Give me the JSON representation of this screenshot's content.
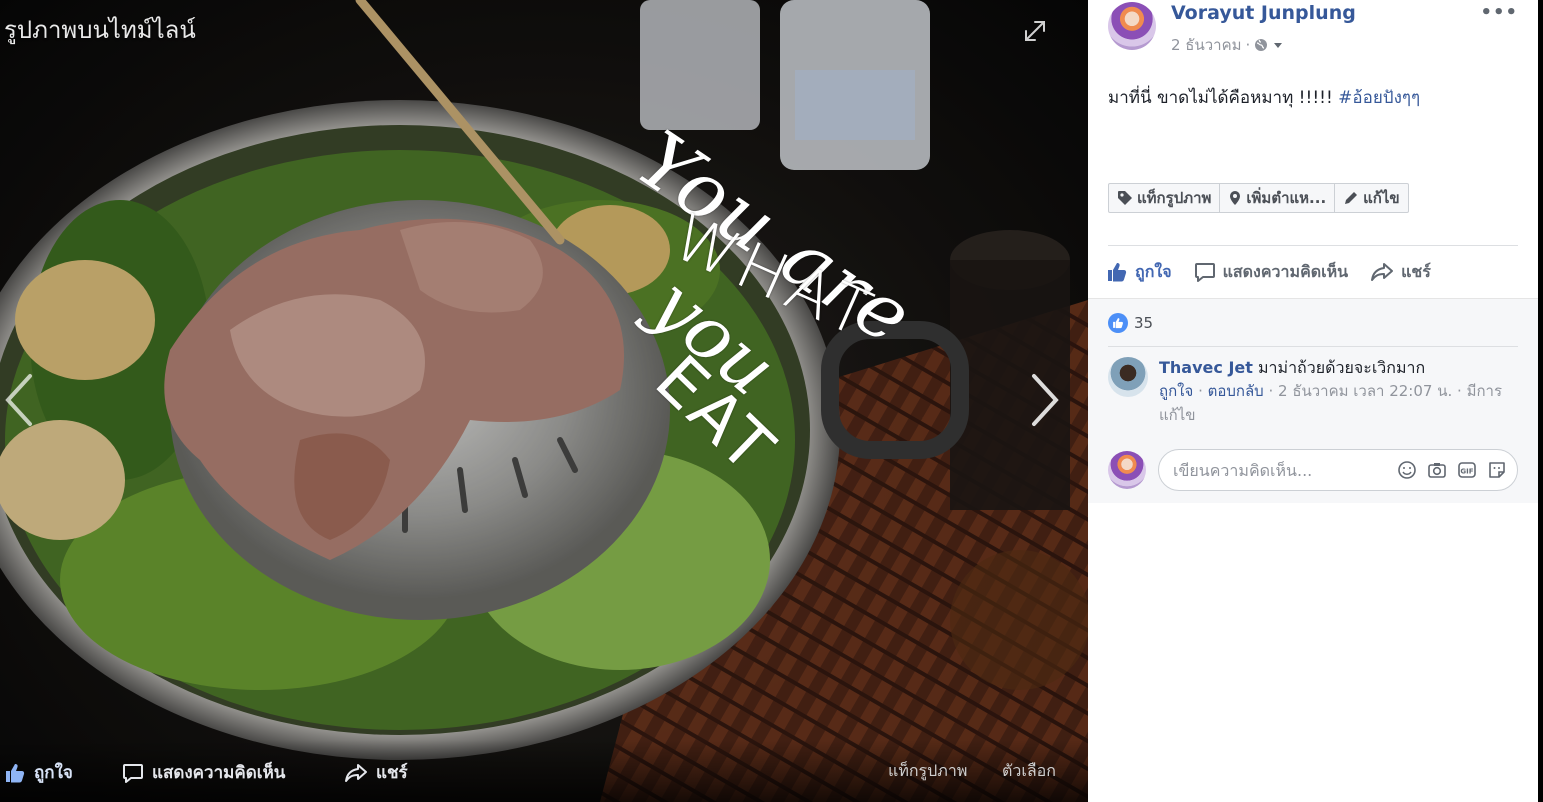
{
  "viewer": {
    "album_title": "รูปภาพบนไทม์ไลน์",
    "overlay_lines": [
      "You are",
      "WHAT",
      "you",
      "EAT"
    ],
    "bottom_actions": {
      "like": "ถูกใจ",
      "comment": "แสดงความคิดเห็น",
      "share": "แชร์"
    },
    "bottom_links": {
      "tag": "แท็กรูปภาพ",
      "options": "ตัวเลือก"
    }
  },
  "post": {
    "author": "Vorayut Junplung",
    "date": "2 ธันวาคม",
    "text": "มาที่นี่ ขาดไม่ได้คือหมาทุ !!!!! ",
    "hashtag": "#อ้อยปังๆๆ",
    "tag_bar": {
      "tag_photo": "แท็กรูปภาพ",
      "add_location": "เพิ่มตำแห...",
      "edit": "แก้ไข"
    },
    "actions": {
      "like": "ถูกใจ",
      "comment": "แสดงความคิดเห็น",
      "share": "แชร์"
    },
    "reaction_count": "35"
  },
  "comments": [
    {
      "name": "Thavec Jet",
      "text": "มาม่าถ้วยด้วยจะเวิกมาก",
      "like": "ถูกใจ",
      "reply": "ตอบกลับ",
      "timestamp": "2 ธันวาคม เวลา 22:07 น.",
      "edited": "มีการแก้ไข"
    }
  ],
  "composer": {
    "placeholder": "เขียนความคิดเห็น..."
  },
  "colors": {
    "link": "#365899",
    "like_blue": "#4267b2",
    "badge": "#4c8ff7",
    "muted": "#90949c"
  },
  "icons": [
    "expand-icon",
    "chevron-left-icon",
    "chevron-right-icon",
    "thumbs-up-icon",
    "comment-icon",
    "share-icon",
    "globe-icon",
    "tag-icon",
    "location-pin-icon",
    "pencil-icon",
    "emoji-icon",
    "camera-icon",
    "gif-icon",
    "sticker-icon"
  ]
}
